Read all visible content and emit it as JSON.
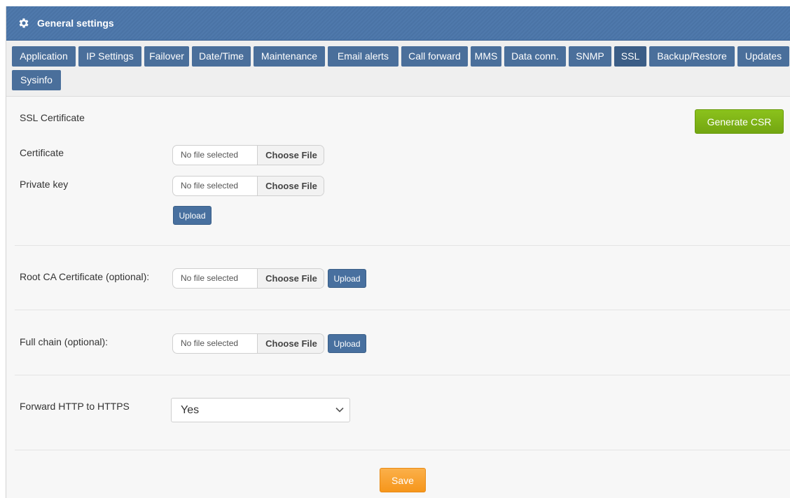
{
  "header": {
    "title": "General settings",
    "icon": "gear-icon"
  },
  "tabs": [
    {
      "label": "Application"
    },
    {
      "label": "IP Settings"
    },
    {
      "label": "Failover"
    },
    {
      "label": "Date/Time"
    },
    {
      "label": "Maintenance"
    },
    {
      "label": "Email alerts"
    },
    {
      "label": "Call forward"
    },
    {
      "label": "MMS"
    },
    {
      "label": "Data conn."
    },
    {
      "label": "SNMP"
    },
    {
      "label": "SSL",
      "active": true
    },
    {
      "label": "Backup/Restore"
    },
    {
      "label": "Updates"
    },
    {
      "label": "Sysinfo"
    }
  ],
  "ssl": {
    "section_title": "SSL Certificate",
    "generate_csr": "Generate CSR",
    "certificate": {
      "label": "Certificate",
      "file": "No file selected",
      "choose": "Choose File"
    },
    "private_key": {
      "label": "Private key",
      "file": "No file selected",
      "choose": "Choose File"
    },
    "upload": "Upload"
  },
  "root_ca": {
    "label": "Root CA Certificate (optional):",
    "file": "No file selected",
    "choose": "Choose File",
    "upload": "Upload"
  },
  "full_chain": {
    "label": "Full chain (optional):",
    "file": "No file selected",
    "choose": "Choose File",
    "upload": "Upload"
  },
  "forward": {
    "label": "Forward HTTP to HTTPS",
    "value": "Yes"
  },
  "save": "Save",
  "colors": {
    "header": "#4a73a5",
    "tab": "#4a6f9b",
    "csr": "#7db317",
    "save": "#f6a030",
    "upload": "#48709f"
  }
}
